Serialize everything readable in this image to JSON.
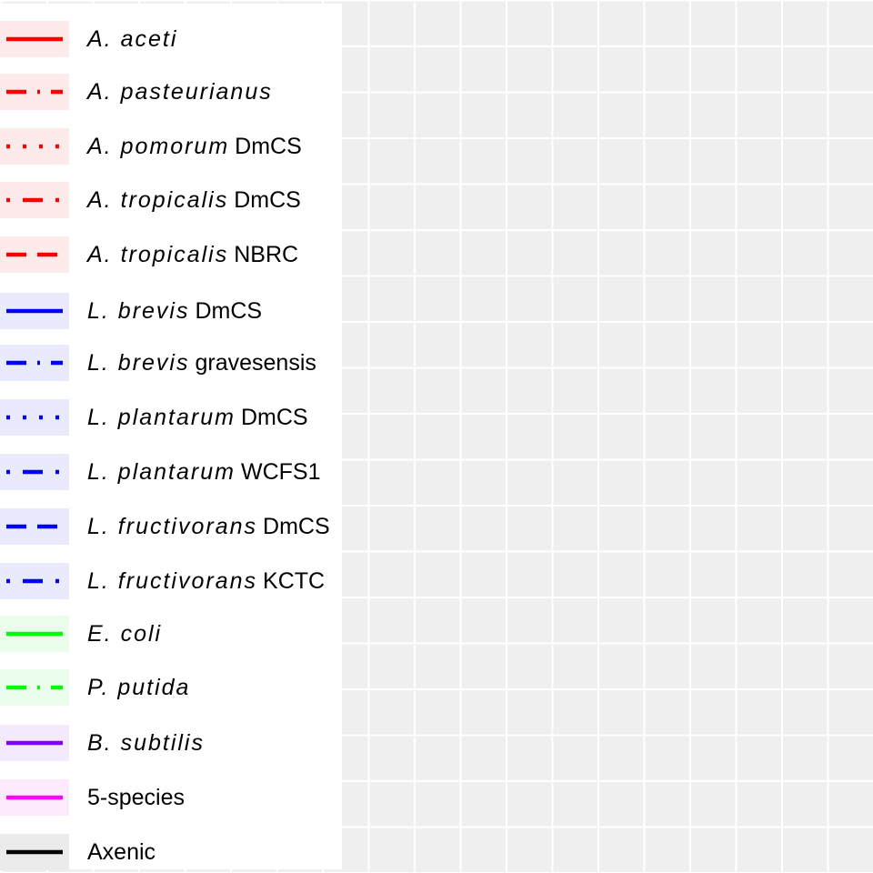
{
  "chart_data": {
    "type": "line",
    "title": "",
    "xlabel": "",
    "ylabel": "",
    "grid": true,
    "legend_placement": "left",
    "series": [
      {
        "name_italic": "A. aceti",
        "name_plain": "",
        "color": "#ff0000",
        "linetype": "solid",
        "key_bg": "#fdeaea"
      },
      {
        "name_italic": "A. pasteurianus",
        "name_plain": "",
        "color": "#ff0000",
        "linetype": "longdash-dot",
        "key_bg": "#fdeaea"
      },
      {
        "name_italic": "A. pomorum",
        "name_plain": "DmCS",
        "color": "#ff0000",
        "linetype": "dotted",
        "key_bg": "#fdeaea"
      },
      {
        "name_italic": "A. tropicalis",
        "name_plain": "DmCS",
        "color": "#ff0000",
        "linetype": "dotdash",
        "key_bg": "#fdeaea"
      },
      {
        "name_italic": "A. tropicalis",
        "name_plain": "NBRC",
        "color": "#ff0000",
        "linetype": "dashed",
        "key_bg": "#fdeaea"
      },
      {
        "name_italic": "L. brevis",
        "name_plain": "DmCS",
        "color": "#0000ff",
        "linetype": "solid",
        "key_bg": "#eaeafd"
      },
      {
        "name_italic": "L. brevis",
        "name_plain": "gravesensis",
        "color": "#0000ff",
        "linetype": "longdash-dot",
        "key_bg": "#eaeafd"
      },
      {
        "name_italic": "L. plantarum",
        "name_plain": "DmCS",
        "color": "#0000ff",
        "linetype": "dotted",
        "key_bg": "#eaeafd"
      },
      {
        "name_italic": "L. plantarum",
        "name_plain": "WCFS1",
        "color": "#0000ff",
        "linetype": "dotdash",
        "key_bg": "#eaeafd"
      },
      {
        "name_italic": "L. fructivorans",
        "name_plain": "DmCS",
        "color": "#0000ff",
        "linetype": "dashed",
        "key_bg": "#eaeafd"
      },
      {
        "name_italic": "L. fructivorans",
        "name_plain": "KCTC",
        "color": "#0000ff",
        "linetype": "dotdash",
        "key_bg": "#eaeafd"
      },
      {
        "name_italic": "E. coli",
        "name_plain": "",
        "color": "#00ff00",
        "linetype": "solid",
        "key_bg": "#ebfdeb"
      },
      {
        "name_italic": "P. putida",
        "name_plain": "",
        "color": "#00ff00",
        "linetype": "longdash-dot",
        "key_bg": "#ebfdeb"
      },
      {
        "name_italic": "B. subtilis",
        "name_plain": "",
        "color": "#8000ff",
        "linetype": "solid",
        "key_bg": "#f3eafd"
      },
      {
        "name_italic": "",
        "name_plain": "5-species",
        "color": "#ff00ff",
        "linetype": "solid",
        "key_bg": "#fdeafd"
      },
      {
        "name_italic": "",
        "name_plain": "Axenic",
        "color": "#000000",
        "linetype": "solid",
        "key_bg": "#ebebeb"
      }
    ]
  }
}
